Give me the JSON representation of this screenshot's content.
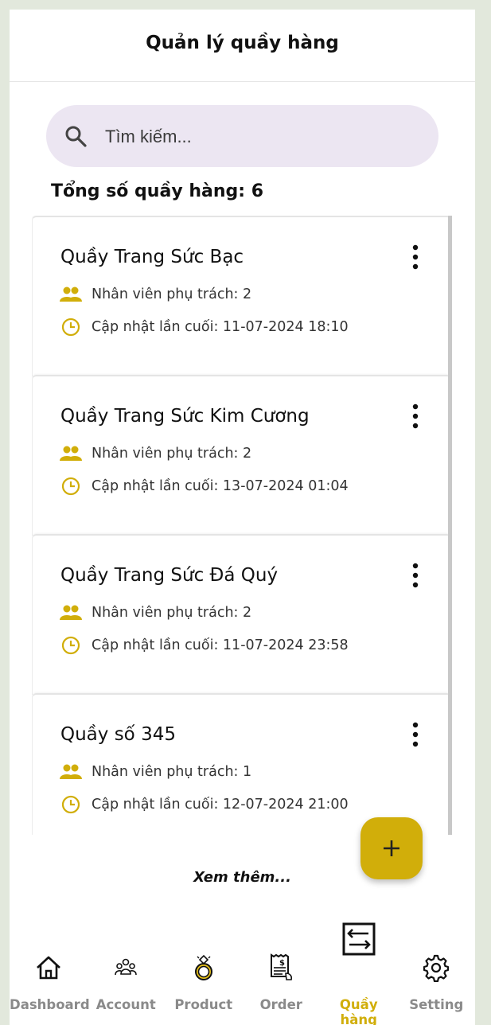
{
  "header": {
    "title": "Quản lý quầy hàng"
  },
  "search": {
    "placeholder": "Tìm kiếm..."
  },
  "summary": {
    "total_text": "Tổng số quầy hàng: 6"
  },
  "counters": [
    {
      "name": "Quầy Trang Sức Bạc",
      "staff": "Nhân viên phụ trách: 2",
      "updated": "Cập nhật lần cuối: 11-07-2024 18:10"
    },
    {
      "name": "Quầy Trang Sức Kim Cương",
      "staff": "Nhân viên phụ trách: 2",
      "updated": "Cập nhật lần cuối: 13-07-2024 01:04"
    },
    {
      "name": "Quầy Trang Sức Đá Quý",
      "staff": "Nhân viên phụ trách: 2",
      "updated": "Cập nhật lần cuối: 11-07-2024 23:58"
    },
    {
      "name": "Quầy số 345",
      "staff": "Nhân viên phụ trách: 1",
      "updated": "Cập nhật lần cuối: 12-07-2024 21:00"
    }
  ],
  "load_more": "Xem thêm...",
  "fab": {
    "icon": "plus-icon"
  },
  "nav": {
    "active": "Quầy hàng",
    "items": [
      {
        "label": "Dashboard",
        "icon": "home-icon"
      },
      {
        "label": "Account",
        "icon": "users-icon"
      },
      {
        "label": "Product",
        "icon": "ring-icon"
      },
      {
        "label": "Order",
        "icon": "receipt-icon"
      },
      {
        "label": "Quầy hàng",
        "icon": "transfer-icon"
      },
      {
        "label": "Setting",
        "icon": "gear-icon"
      }
    ]
  },
  "colors": {
    "accent": "#d1ae0a",
    "search_bg": "#ece6f2",
    "page_bg": "#e2e8dc"
  }
}
